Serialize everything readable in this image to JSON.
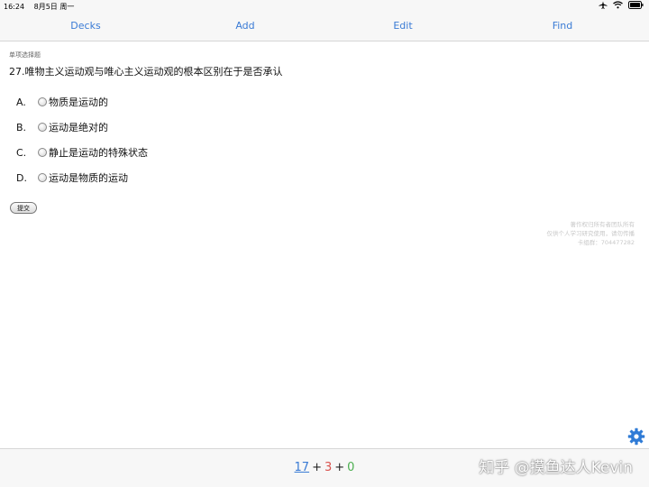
{
  "status_bar": {
    "time": "16:24",
    "date": "8月5日 周一"
  },
  "nav": {
    "decks": "Decks",
    "add": "Add",
    "edit": "Edit",
    "find": "Find"
  },
  "question": {
    "type": "单项选择题",
    "title": "27.唯物主义运动观与唯心主义运动观的根本区别在于是否承认",
    "options": [
      {
        "letter": "A.",
        "text": "物质是运动的"
      },
      {
        "letter": "B.",
        "text": "运动是绝对的"
      },
      {
        "letter": "C.",
        "text": "静止是运动的特殊状态"
      },
      {
        "letter": "D.",
        "text": "运动是物质的运动"
      }
    ],
    "submit_label": "提交"
  },
  "watermark": [
    "著作权归所有者团队所有",
    "仅供个人学习研究使用，请勿传播",
    "卡组群：704477282"
  ],
  "counts": {
    "new": "17",
    "learn": "3",
    "review": "0",
    "plus": "+"
  },
  "credit": "知乎 @摸鱼达人Kevin",
  "colors": {
    "accent": "#3a7bd5",
    "learn": "#d9534f",
    "review": "#4caf50"
  },
  "icons": [
    "airplane-icon",
    "wifi-icon",
    "battery-icon",
    "gear-icon"
  ]
}
